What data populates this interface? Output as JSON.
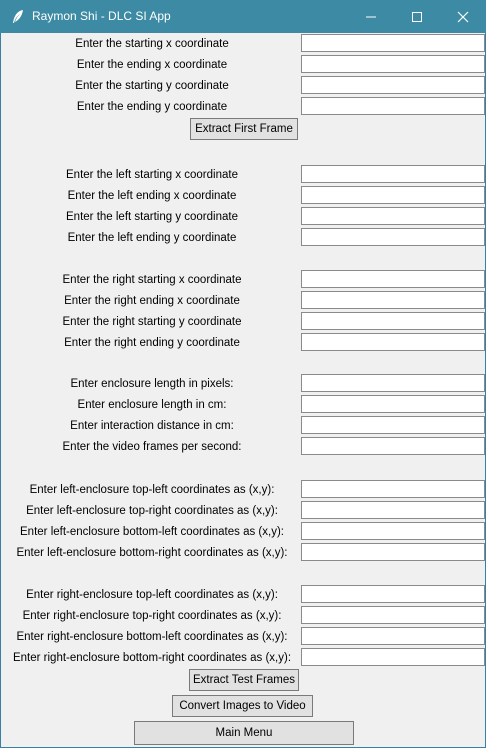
{
  "window": {
    "title": "Raymon Shi - DLC SI App",
    "app_icon": "feather-icon"
  },
  "controls": {
    "minimize": "minimize-icon",
    "maximize": "maximize-icon",
    "close": "close-icon"
  },
  "fields": {
    "labels": [
      "Enter the starting x coordinate",
      "Enter the ending x coordinate",
      "Enter the starting y coordinate",
      "Enter the ending y coordinate",
      "Enter the left starting x coordinate",
      "Enter the left ending x coordinate",
      "Enter the left starting y coordinate",
      "Enter the left ending y coordinate",
      "Enter the right starting x coordinate",
      "Enter the right ending x coordinate",
      "Enter the right starting y coordinate",
      "Enter the right ending y coordinate",
      "Enter enclosure length in pixels:",
      "Enter enclosure length in cm:",
      "Enter interaction distance in cm:",
      "Enter the video frames per second:",
      "Enter left-enclosure top-left coordinates as (x,y):",
      "Enter left-enclosure top-right coordinates as (x,y):",
      "Enter left-enclosure bottom-left coordinates as (x,y):",
      "Enter left-enclosure bottom-right coordinates as (x,y):",
      "Enter right-enclosure top-left coordinates as (x,y):",
      "Enter right-enclosure top-right coordinates as (x,y):",
      "Enter right-enclosure bottom-left coordinates as (x,y):",
      "Enter right-enclosure bottom-right coordinates as (x,y):"
    ]
  },
  "buttons": {
    "extract_first_frame": "Extract First Frame",
    "extract_test_frames": "Extract Test Frames",
    "convert_images": "Convert Images to Video",
    "main_menu": "Main Menu"
  },
  "colors": {
    "titlebar": "#3c8aa4",
    "window_bg": "#f0f0f0",
    "button_bg": "#e1e1e1"
  }
}
